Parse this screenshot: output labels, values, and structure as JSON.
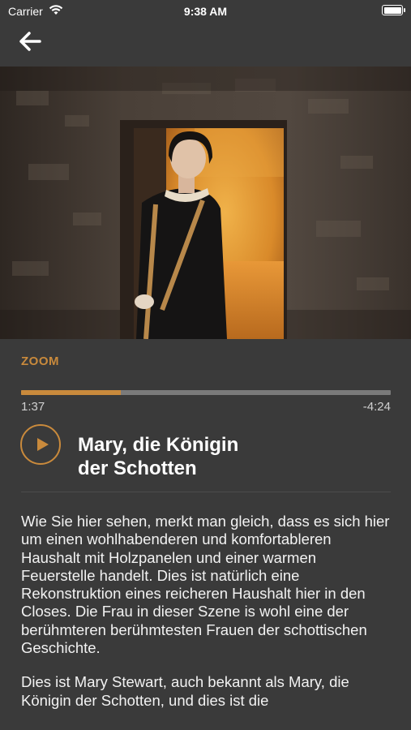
{
  "status_bar": {
    "carrier": "Carrier",
    "time": "9:38 AM"
  },
  "nav": {
    "back_icon": "arrow-left-icon"
  },
  "hero": {
    "image": "portrait-of-woman-in-period-costume"
  },
  "section_label": "ZOOM",
  "player": {
    "elapsed": "1:37",
    "remaining": "-4:24",
    "progress": 0.27,
    "play_icon": "play-icon"
  },
  "track": {
    "title_line1": "Mary, die Königin",
    "title_line2": "der Schotten"
  },
  "body": {
    "paragraph1": "Wie Sie hier sehen, merkt man gleich, dass es sich hier um einen wohlhabenderen und komfortableren Haushalt mit Holzpanelen und einer warmen Feuerstelle handelt. Dies ist natürlich eine Rekonstruktion eines reicheren Haushalt hier in den Closes. Die Frau in dieser Szene is wohl eine der berühmteren berühmtesten Frauen der schottischen Geschichte.",
    "paragraph2": "Dies ist Mary Stewart, auch bekannt als Mary, die Königin der Schotten, und dies ist die"
  },
  "colors": {
    "accent": "#c98a3c",
    "background": "#3a3a3a",
    "track": "#7a7a7a"
  }
}
